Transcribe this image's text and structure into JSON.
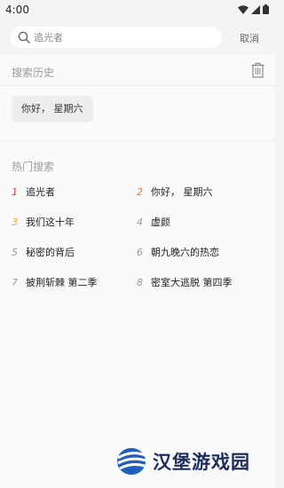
{
  "status": {
    "time": "4:00"
  },
  "search": {
    "placeholder": "追光者",
    "value": "",
    "cancel_label": "取消"
  },
  "history": {
    "title": "搜索历史",
    "items": [
      "你好， 星期六"
    ]
  },
  "hot": {
    "title": "热门搜索",
    "items": [
      {
        "rank": "1",
        "label": "追光者"
      },
      {
        "rank": "2",
        "label": "你好， 星期六"
      },
      {
        "rank": "3",
        "label": "我们这十年"
      },
      {
        "rank": "4",
        "label": "虚颜"
      },
      {
        "rank": "5",
        "label": "秘密的背后"
      },
      {
        "rank": "6",
        "label": "朝九晚六的热恋"
      },
      {
        "rank": "7",
        "label": "披荆斩棘 第二季"
      },
      {
        "rank": "8",
        "label": "密室大逃脱 第四季"
      }
    ],
    "rank_colors": {
      "1": "#e53935",
      "2": "#f4722b",
      "3": "#f6a823",
      "other": "#999999"
    }
  },
  "watermark": {
    "text": "汉堡游戏园"
  }
}
